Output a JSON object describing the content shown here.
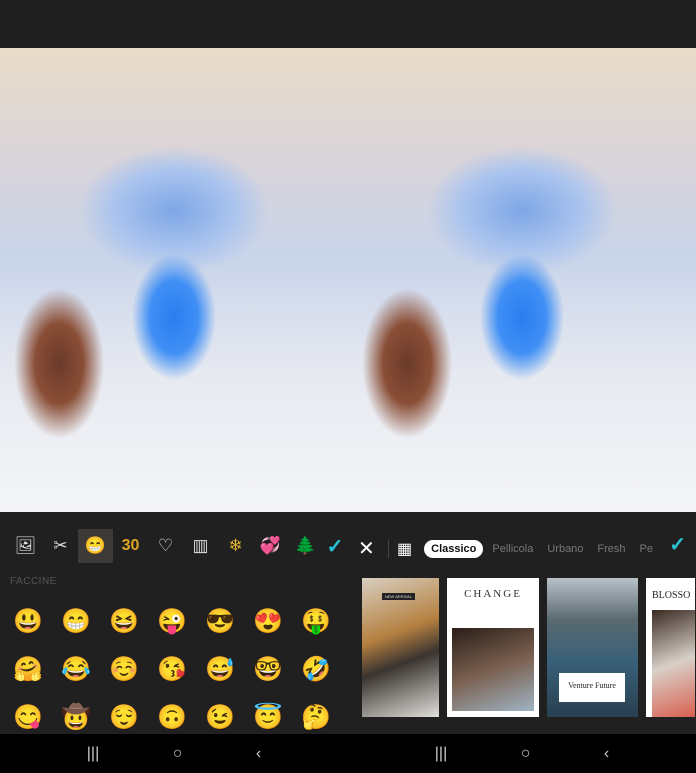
{
  "left_panel": {
    "tools": [
      {
        "icon": "gallery-icon",
        "glyph": "🖼"
      },
      {
        "icon": "cutout-icon",
        "glyph": "✂"
      },
      {
        "icon": "emoji-sticker-icon",
        "glyph": "😁",
        "active": true
      },
      {
        "icon": "number-30-icon",
        "glyph": "30"
      },
      {
        "icon": "heart-icon",
        "glyph": "♡"
      },
      {
        "icon": "texture-icon",
        "glyph": "▥"
      },
      {
        "icon": "snowflake-icon",
        "glyph": "❄"
      },
      {
        "icon": "hearts-icon",
        "glyph": "💞"
      },
      {
        "icon": "christmas-tree-icon",
        "glyph": "🌲"
      }
    ],
    "confirm": "✓",
    "section_title": "FACCINE",
    "emojis": [
      "😃",
      "😁",
      "😆",
      "😜",
      "😎",
      "😍",
      "🤑",
      "🤗",
      "😂",
      "☺️",
      "😘",
      "😅",
      "🤓",
      "🤣",
      "😋",
      "🤠",
      "😌",
      "🙃",
      "😉",
      "😇",
      "🤔"
    ]
  },
  "right_panel": {
    "close": "✕",
    "layout_icon": "▦",
    "filters": [
      "Classico",
      "Pellicola",
      "Urbano",
      "Fresh",
      "Pe"
    ],
    "selected_filter": "Classico",
    "confirm": "✓",
    "templates": [
      {
        "tag": "NEW ARRIVAL"
      },
      {
        "title": "CHANGE"
      },
      {
        "title": "Venture Future"
      },
      {
        "title": "BLOSSO"
      }
    ]
  },
  "navbar": {
    "recents": "|||",
    "home": "○",
    "back": "‹"
  },
  "colors": {
    "accent": "#29c4d8",
    "background": "#1f1f1f",
    "active_tool": "#3e3a38"
  }
}
